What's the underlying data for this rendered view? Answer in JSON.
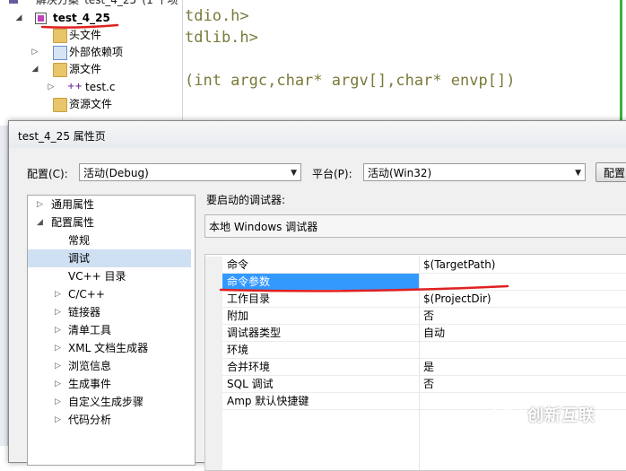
{
  "explorer": {
    "solution_label": "解决方案“test_4_25”(1 个项",
    "project": "test_4_25",
    "items": [
      {
        "label": "头文件"
      },
      {
        "label": "外部依赖项"
      },
      {
        "label": "源文件"
      },
      {
        "label": "test.c"
      },
      {
        "label": "资源文件"
      }
    ]
  },
  "editor": {
    "lines": [
      "tdio.h>",
      "tdlib.h>",
      "(int argc,char* argv[],char* envp[])"
    ]
  },
  "dialog": {
    "title": "test_4_25 属性页",
    "config_label": "配置(C):",
    "config_value": "活动(Debug)",
    "platform_label": "平台(P):",
    "platform_value": "活动(Win32)",
    "config_manager_label": "配置",
    "debugger_to_launch_label": "要启动的调试器:",
    "debugger_value": "本地 Windows 调试器",
    "nav": [
      {
        "label": "通用属性"
      },
      {
        "label": "配置属性"
      },
      {
        "label": "常规"
      },
      {
        "label": "调试"
      },
      {
        "label": "VC++ 目录"
      },
      {
        "label": "C/C++"
      },
      {
        "label": "链接器"
      },
      {
        "label": "清单工具"
      },
      {
        "label": "XML 文档生成器"
      },
      {
        "label": "浏览信息"
      },
      {
        "label": "生成事件"
      },
      {
        "label": "自定义生成步骤"
      },
      {
        "label": "代码分析"
      }
    ],
    "properties": [
      {
        "key": "命令",
        "value": "$(TargetPath)"
      },
      {
        "key": "命令参数",
        "value": ""
      },
      {
        "key": "工作目录",
        "value": "$(ProjectDir)"
      },
      {
        "key": "附加",
        "value": "否"
      },
      {
        "key": "调试器类型",
        "value": "自动"
      },
      {
        "key": "环境",
        "value": ""
      },
      {
        "key": "合并环境",
        "value": "是"
      },
      {
        "key": "SQL 调试",
        "value": "否"
      },
      {
        "key": "Amp 默认快捷键",
        "value": ""
      }
    ]
  },
  "watermark": {
    "text": "创新互联"
  },
  "colors": {
    "selection": "#3399ff",
    "annotation_red": "#e02020",
    "tree_selection": "#cfe0f3"
  }
}
